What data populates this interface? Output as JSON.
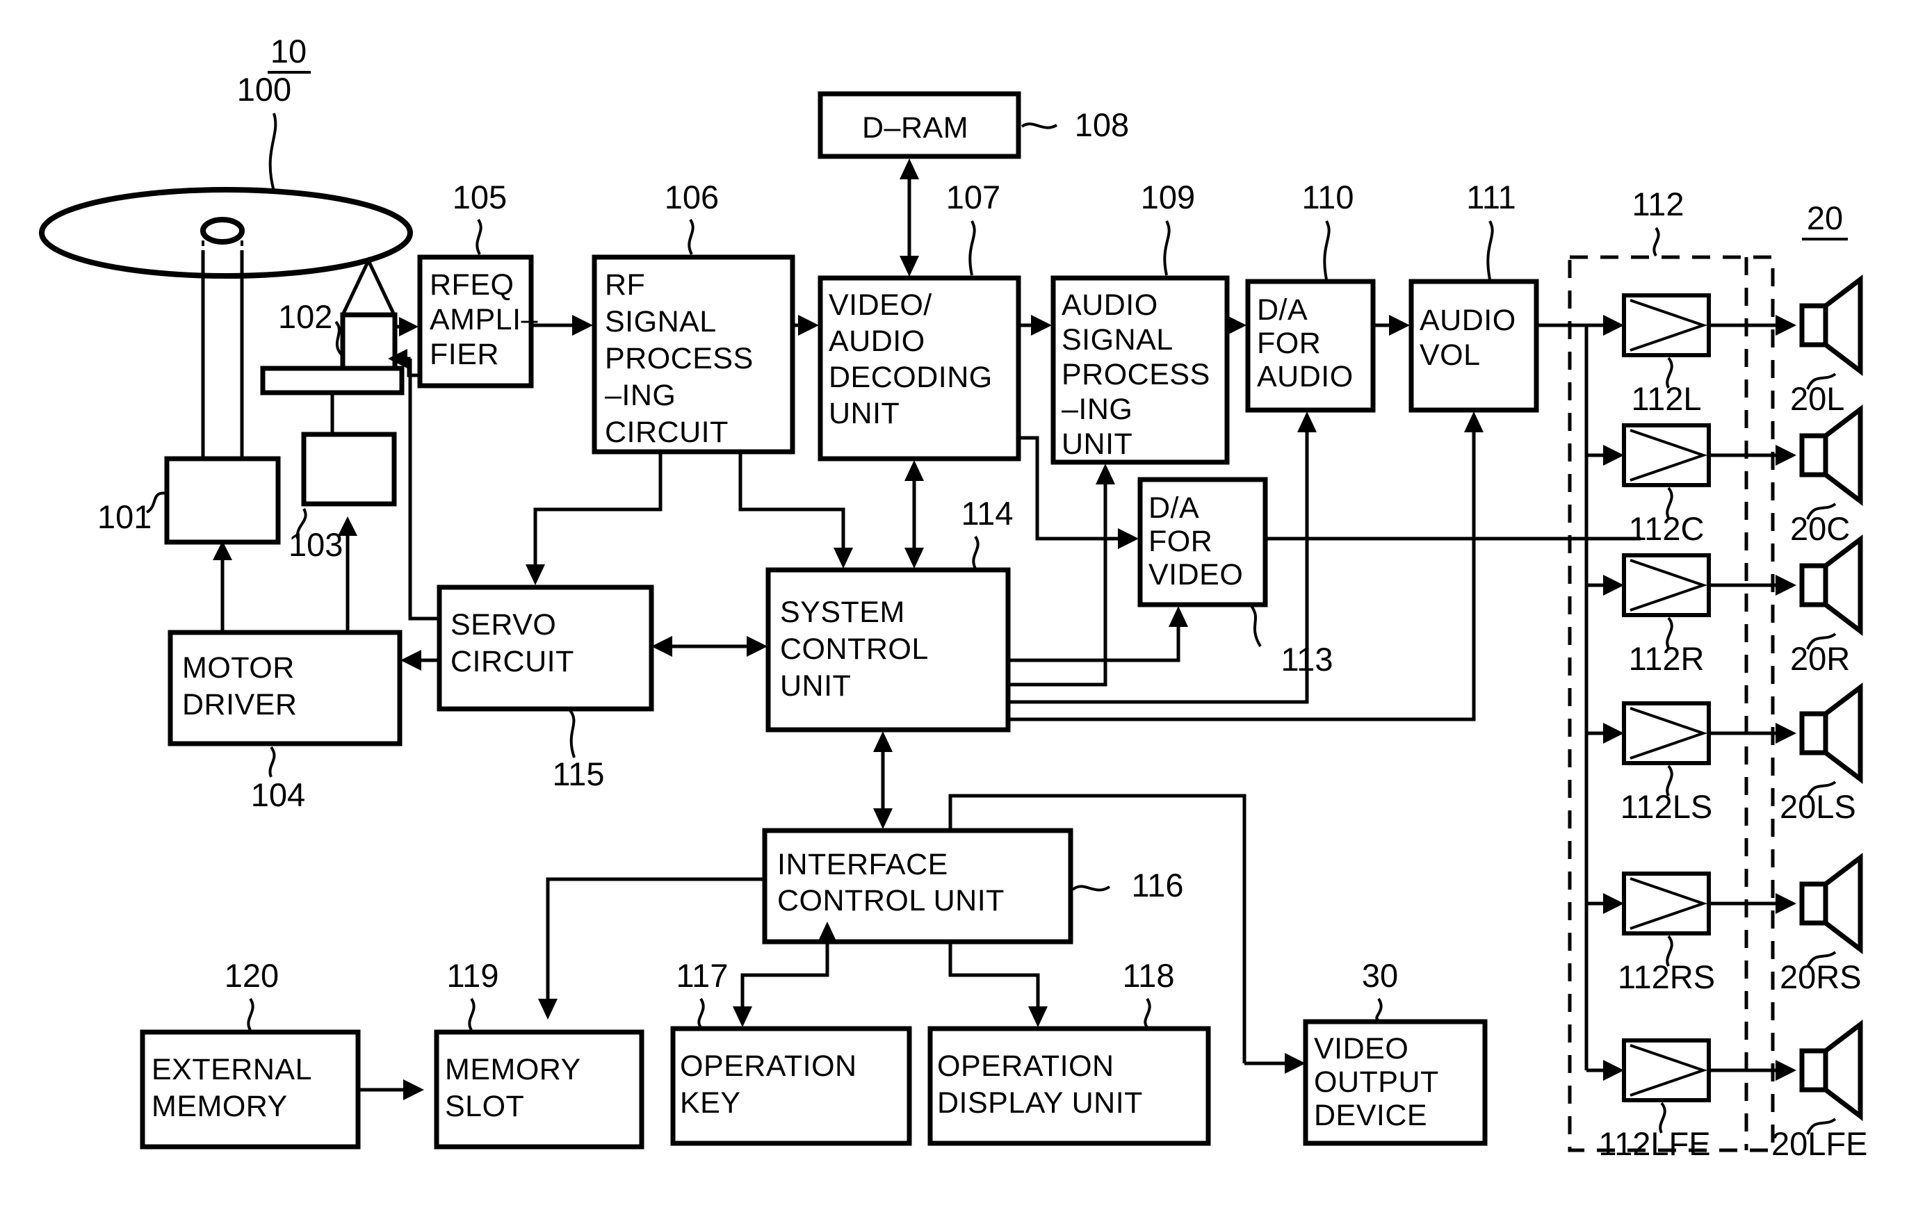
{
  "figure": {
    "system_ref": "10",
    "speaker_group_ref": "20"
  },
  "blocks": {
    "rfeq_amplifier": {
      "label_lines": [
        "RFEQ",
        "AMPLI–",
        "FIER"
      ],
      "ref": "105"
    },
    "rf_signal_processing_circuit": {
      "label_lines": [
        "RF",
        "SIGNAL",
        "PROCESS",
        "–ING",
        "CIRCUIT"
      ],
      "ref": "106"
    },
    "video_audio_decoding_unit": {
      "label_lines": [
        "VIDEO/",
        "AUDIO",
        "DECODING",
        "UNIT"
      ],
      "ref": "107"
    },
    "dram": {
      "label_lines": [
        "D–RAM"
      ],
      "ref": "108"
    },
    "audio_signal_processing_unit": {
      "label_lines": [
        "AUDIO",
        "SIGNAL",
        "PROCESS",
        "–ING",
        "UNIT"
      ],
      "ref": "109"
    },
    "da_for_audio": {
      "label_lines": [
        "D/A",
        "FOR",
        "AUDIO"
      ],
      "ref": "110"
    },
    "audio_vol": {
      "label_lines": [
        "AUDIO",
        "VOL"
      ],
      "ref": "111"
    },
    "da_for_video": {
      "label_lines": [
        "D/A",
        "FOR",
        "VIDEO"
      ],
      "ref": "113"
    },
    "servo_circuit": {
      "label_lines": [
        "SERVO",
        "CIRCUIT"
      ],
      "ref": "115"
    },
    "system_control_unit": {
      "label_lines": [
        "SYSTEM",
        "CONTROL",
        "UNIT"
      ],
      "ref": "114"
    },
    "motor_driver": {
      "label_lines": [
        "MOTOR",
        "DRIVER"
      ],
      "ref": "104"
    },
    "interface_control_unit": {
      "label_lines": [
        "INTERFACE",
        "CONTROL UNIT"
      ],
      "ref": "116"
    },
    "external_memory": {
      "label_lines": [
        "EXTERNAL",
        "MEMORY"
      ],
      "ref": "120"
    },
    "memory_slot": {
      "label_lines": [
        "MEMORY",
        "SLOT"
      ],
      "ref": "119"
    },
    "operation_key": {
      "label_lines": [
        "OPERATION",
        "KEY"
      ],
      "ref": "117"
    },
    "operation_display_unit": {
      "label_lines": [
        "OPERATION",
        "DISPLAY UNIT"
      ],
      "ref": "118"
    },
    "video_output_device": {
      "label_lines": [
        "VIDEO",
        "OUTPUT",
        "DEVICE"
      ],
      "ref": "30"
    },
    "optical_disc": {
      "ref": "100"
    },
    "optical_pickup": {
      "ref": "102"
    },
    "spindle_motor": {
      "ref": "101"
    },
    "sled_motor": {
      "ref": "103"
    },
    "amp_group": {
      "ref": "112"
    }
  },
  "amplifier_channels": [
    {
      "ref": "112L",
      "speaker_ref": "20L"
    },
    {
      "ref": "112C",
      "speaker_ref": "20C"
    },
    {
      "ref": "112R",
      "speaker_ref": "20R"
    },
    {
      "ref": "112LS",
      "speaker_ref": "20LS"
    },
    {
      "ref": "112RS",
      "speaker_ref": "20RS"
    },
    {
      "ref": "112LFE",
      "speaker_ref": "20LFE"
    }
  ]
}
